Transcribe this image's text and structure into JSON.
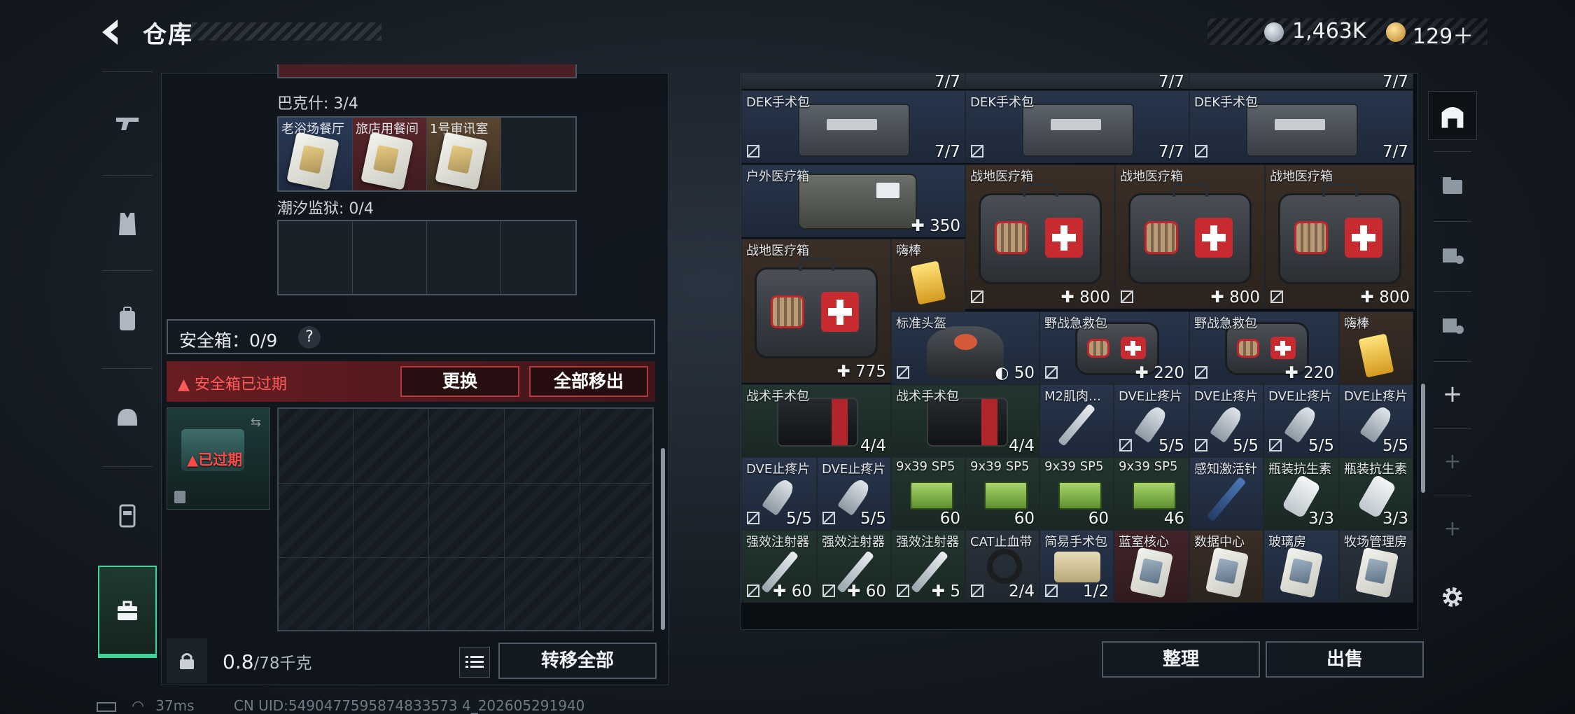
{
  "header": {
    "title": "仓库",
    "currency_a": "1,463K",
    "currency_b": "129＋"
  },
  "left_nav": [
    "gun-icon",
    "armor-icon",
    "backpack-icon",
    "helmet-icon",
    "vest-icon",
    "toolbox-icon"
  ],
  "keycards": {
    "bakeshi_label": "巴克什: 3/4",
    "bakeshi_cells": [
      "老浴场餐厅",
      "旅店用餐间",
      "1号审讯室",
      ""
    ],
    "tide_label": "潮汐监狱: 0/4",
    "tide_cells": [
      "",
      "",
      "",
      ""
    ]
  },
  "safe": {
    "title": "安全箱：0/9",
    "help": "?",
    "warning": "安全箱已过期",
    "replace_btn": "更换",
    "remove_all_btn": "全部移出",
    "expired": "已过期"
  },
  "bottom_left": {
    "weight_value": "0.8",
    "weight_max": "/78千克",
    "transfer_all_btn": "转移全部"
  },
  "inventory": {
    "top_row_counts": [
      "7/7",
      "7/7",
      "7/7"
    ],
    "items": [
      {
        "name": "DEK手术包",
        "count": "7/7"
      },
      {
        "name": "DEK手术包",
        "count": "7/7"
      },
      {
        "name": "DEK手术包",
        "count": "7/7"
      },
      {
        "name": "户外医疗箱",
        "count": "✚ 350"
      },
      {
        "name": "战地医疗箱",
        "count": "✚ 800"
      },
      {
        "name": "战地医疗箱",
        "count": "✚ 800"
      },
      {
        "name": "战地医疗箱",
        "count": "✚ 800"
      },
      {
        "name": "战地医疗箱",
        "count": "✚ 775"
      },
      {
        "name": "嗨棒",
        "count": ""
      },
      {
        "name": "标准头盔",
        "count": "◐ 50"
      },
      {
        "name": "野战急救包",
        "count": "✚ 220"
      },
      {
        "name": "野战急救包",
        "count": "✚ 220"
      },
      {
        "name": "嗨棒",
        "count": ""
      },
      {
        "name": "战术手术包",
        "count": "4/4"
      },
      {
        "name": "战术手术包",
        "count": "4/4"
      },
      {
        "name": "M2肌肉…",
        "count": ""
      },
      {
        "name": "DVE止疼片",
        "count": "5/5"
      },
      {
        "name": "DVE止疼片",
        "count": "5/5"
      },
      {
        "name": "DVE止疼片",
        "count": "5/5"
      },
      {
        "name": "DVE止疼片",
        "count": "5/5"
      },
      {
        "name": "DVE止疼片",
        "count": "5/5"
      },
      {
        "name": "9x39 SP5",
        "count": "60"
      },
      {
        "name": "9x39 SP5",
        "count": "60"
      },
      {
        "name": "9x39 SP5",
        "count": "60"
      },
      {
        "name": "9x39 SP5",
        "count": "46"
      },
      {
        "name": "感知激活针",
        "count": ""
      },
      {
        "name": "瓶装抗生素",
        "count": "3/3"
      },
      {
        "name": "瓶装抗生素",
        "count": "3/3"
      },
      {
        "name": "强效注射器",
        "count": "✚ 60"
      },
      {
        "name": "强效注射器",
        "count": "✚ 60"
      },
      {
        "name": "强效注射器",
        "count": "✚ 5"
      },
      {
        "name": "CAT止血带",
        "count": "2/4"
      },
      {
        "name": "简易手术包",
        "count": "1/2"
      },
      {
        "name": "蓝室核心",
        "count": ""
      },
      {
        "name": "数据中心",
        "count": ""
      },
      {
        "name": "玻璃房",
        "count": ""
      },
      {
        "name": "牧场管理房",
        "count": ""
      }
    ]
  },
  "bottom_right": {
    "organize_btn": "整理",
    "sell_btn": "出售"
  },
  "status": {
    "ping": "37ms",
    "uid": "CN UID:5490477595874833573 4_202605291940"
  },
  "colors": {
    "accent_green": "#3fd39a",
    "warning_red": "#ff5b5b",
    "panel_bg": "#10151b"
  }
}
